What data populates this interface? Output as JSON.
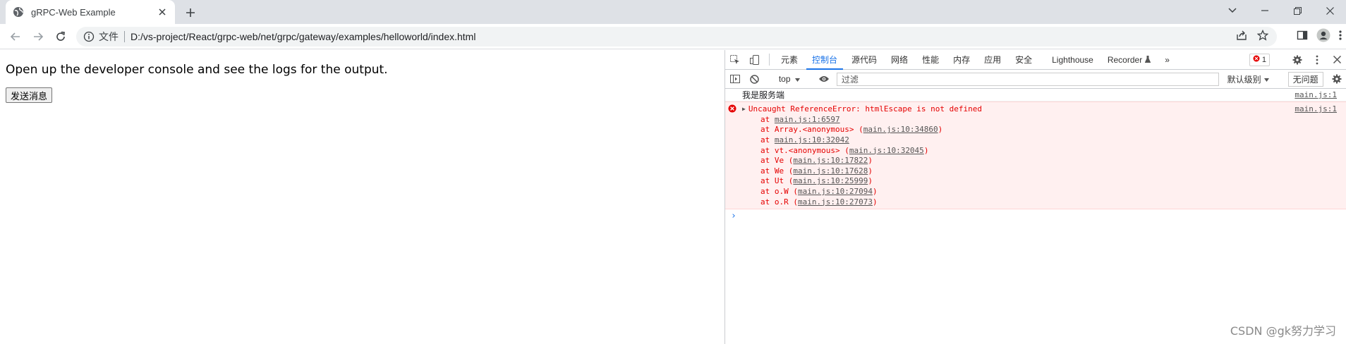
{
  "browser": {
    "tab": {
      "title": "gRPC-Web Example"
    },
    "omnibox": {
      "scheme_label": "文件",
      "url": "D:/vs-project/React/grpc-web/net/grpc/gateway/examples/helloworld/index.html"
    }
  },
  "page": {
    "intro_text": "Open up the developer console and see the logs for the output.",
    "send_button_label": "发送消息"
  },
  "devtools": {
    "tabs": [
      {
        "label": "元素",
        "active": false
      },
      {
        "label": "控制台",
        "active": true
      },
      {
        "label": "源代码",
        "active": false
      },
      {
        "label": "网络",
        "active": false
      },
      {
        "label": "性能",
        "active": false
      },
      {
        "label": "内存",
        "active": false
      },
      {
        "label": "应用",
        "active": false
      },
      {
        "label": "安全",
        "active": false
      },
      {
        "label": "Lighthouse",
        "active": false
      },
      {
        "label": "Recorder",
        "active": false
      }
    ],
    "more_tabs_label": "»",
    "error_count": "1",
    "toolbar": {
      "context": "top",
      "filter_placeholder": "过滤",
      "levels_label": "默认级别",
      "issues_label": "无问题"
    },
    "console": {
      "log": {
        "text": "我是服务端",
        "source": "main.js:1"
      },
      "error": {
        "message": "Uncaught ReferenceError: htmlEscape is not defined",
        "source": "main.js:1",
        "stack": [
          {
            "prefix": "at ",
            "link": "main.js:1:6597",
            "suffix": ""
          },
          {
            "prefix": "at Array.<anonymous> (",
            "link": "main.js:10:34860",
            "suffix": ")"
          },
          {
            "prefix": "at ",
            "link": "main.js:10:32042",
            "suffix": ""
          },
          {
            "prefix": "at vt.<anonymous> (",
            "link": "main.js:10:32045",
            "suffix": ")"
          },
          {
            "prefix": "at Ve (",
            "link": "main.js:10:17822",
            "suffix": ")"
          },
          {
            "prefix": "at We (",
            "link": "main.js:10:17628",
            "suffix": ")"
          },
          {
            "prefix": "at Ut (",
            "link": "main.js:10:25999",
            "suffix": ")"
          },
          {
            "prefix": "at o.W (",
            "link": "main.js:10:27094",
            "suffix": ")"
          },
          {
            "prefix": "at o.R (",
            "link": "main.js:10:27073",
            "suffix": ")"
          }
        ]
      },
      "prompt": "›"
    }
  },
  "watermark": "CSDN @gk努力学习",
  "colors": {
    "accent": "#1a73e8",
    "error_text": "#e50000",
    "error_bg": "#fff0f0"
  }
}
